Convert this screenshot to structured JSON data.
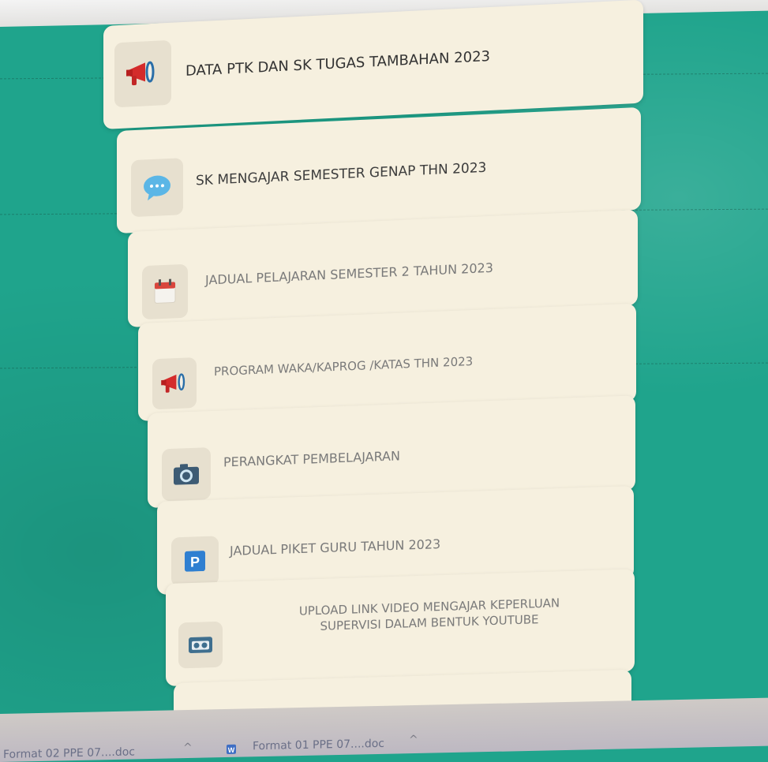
{
  "menu": {
    "items": [
      {
        "label": "DATA PTK DAN SK TUGAS TAMBAHAN 2023",
        "icon": "megaphone-icon"
      },
      {
        "label": "SK MENGAJAR SEMESTER GENAP THN 2023",
        "icon": "chat-bubble-icon"
      },
      {
        "label": "JADUAL PELAJARAN SEMESTER 2 TAHUN 2023",
        "icon": "calendar-icon"
      },
      {
        "label": "PROGRAM WAKA/KAPROG /KATAS THN 2023",
        "icon": "megaphone-icon"
      },
      {
        "label": "PERANGKAT PEMBELAJARAN",
        "icon": "camera-icon"
      },
      {
        "label": "JADUAL PIKET GURU TAHUN 2023",
        "icon": "parking-icon"
      },
      {
        "label_line1": "UPLOAD LINK VIDEO MENGAJAR KEPERLUAN",
        "label_line2": "SUPERVISI DALAM BENTUK YOUTUBE",
        "icon": "video-tape-icon"
      }
    ]
  },
  "downloads": {
    "items": [
      {
        "name": "Format 02 PPE 07....doc"
      },
      {
        "name": "Format 01 PPE 07....doc"
      }
    ]
  },
  "colors": {
    "background": "#1fa48c",
    "card": "#f6f0df",
    "megaphone_red": "#d42b2b",
    "chat_blue": "#5bb6e6",
    "parking_blue": "#2f7fd1"
  }
}
